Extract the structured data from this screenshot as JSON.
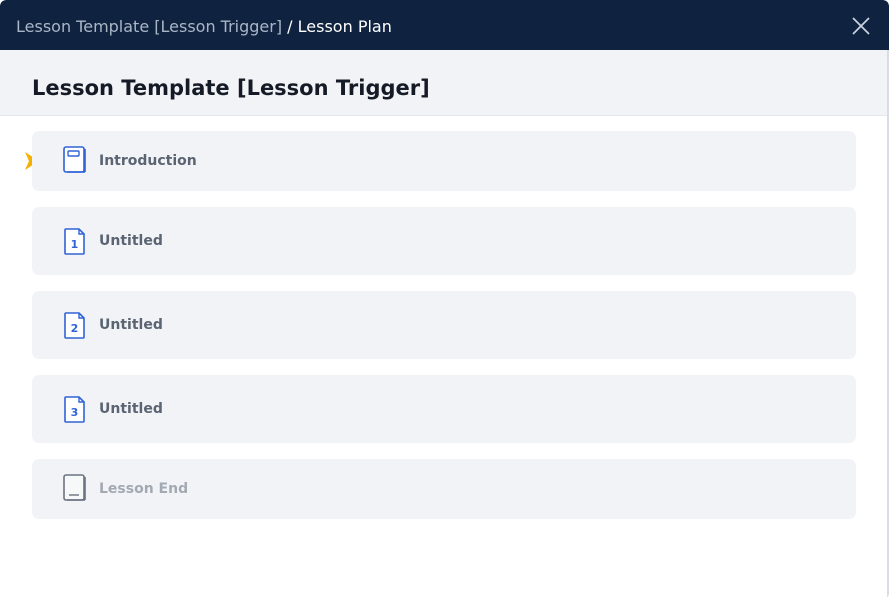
{
  "header": {
    "breadcrumb_parent": "Lesson Template [Lesson Trigger]",
    "breadcrumb_separator": " / ",
    "breadcrumb_current": "Lesson Plan",
    "close_icon": "close-icon"
  },
  "title": "Lesson Template [Lesson Trigger]",
  "colors": {
    "header_bg": "#0f2340",
    "item_bg": "#f2f3f7",
    "icon_blue": "#2f63d6",
    "pointer": "#f5b100",
    "disabled_text": "#a3a9b3"
  },
  "plan": {
    "current_indicator_icon": "play-pointer-icon",
    "items": [
      {
        "label": "Introduction",
        "icon": "book-icon",
        "number": ""
      },
      {
        "label": "Untitled",
        "icon": "numbered-page-icon",
        "number": "1"
      },
      {
        "label": "Untitled",
        "icon": "numbered-page-icon",
        "number": "2"
      },
      {
        "label": "Untitled",
        "icon": "numbered-page-icon",
        "number": "3"
      },
      {
        "label": "Lesson End",
        "icon": "book-end-icon",
        "number": ""
      }
    ]
  }
}
